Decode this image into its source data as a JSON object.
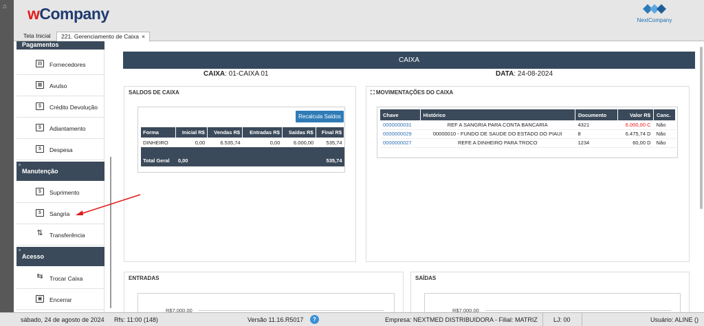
{
  "header": {
    "brand_w": "w",
    "brand_rest": "Company",
    "partner": "NextCompany"
  },
  "tabs": [
    {
      "label": "Tela Inicial"
    },
    {
      "label": "221. Gerenciamento de Caixa",
      "close": "×"
    }
  ],
  "sidebar": {
    "sections": [
      {
        "label": "Pagamentos"
      },
      {
        "label": "Manutenção"
      },
      {
        "label": "Acesso"
      }
    ],
    "items": [
      {
        "label": "Fornecedores",
        "icon": "truck-icon"
      },
      {
        "label": "Avulso",
        "icon": "register-icon"
      },
      {
        "label": "Crédito Devolução",
        "icon": "money-hand-icon"
      },
      {
        "label": "Adiantamento",
        "icon": "cash-icon"
      },
      {
        "label": "Despesa",
        "icon": "document-money-icon"
      },
      {
        "label": "Suprimento",
        "icon": "cash-in-icon"
      },
      {
        "label": "Sangria",
        "icon": "cash-out-icon"
      },
      {
        "label": "Transferência",
        "icon": "transfer-arrows-icon"
      },
      {
        "label": "Trocar Caixa",
        "icon": "swap-icon"
      },
      {
        "label": "Encerrar",
        "icon": "cash-register-icon"
      }
    ]
  },
  "main": {
    "banner": "CAIXA",
    "caixa_label": "CAIXA",
    "caixa_value": ": 01-CAIXA 01",
    "data_label": "DATA",
    "data_value": ": 24-08-2024",
    "saldos": {
      "title": "SALDOS DE CAIXA",
      "button": "Recalcula Saldos",
      "columns": [
        "Forma",
        "Inicial R$",
        "Vendas R$",
        "Entradas R$",
        "Saídas R$",
        "Final R$"
      ],
      "rows": [
        [
          "DINHEIRO",
          "0,00",
          "6.535,74",
          "0,00",
          "6.000,00",
          "535,74"
        ]
      ],
      "total": {
        "label": "Total Geral",
        "inicial": "0,00",
        "final": "535,74"
      }
    },
    "movimentacoes": {
      "title": "MOVIMENTAÇÕES DO CAIXA",
      "columns": [
        "Chave",
        "Histórico",
        "Documento",
        "Valor R$",
        "Canc."
      ],
      "rows": [
        [
          "0000000031",
          "REF A SANGRIA PARA CONTA BANCARIA",
          "4321",
          "6.000,00 C",
          "Não"
        ],
        [
          "0000000029",
          "00000010 - FUNDO DE SAUDE DO ESTADO DO PIAUI",
          "8",
          "6.475,74 D",
          "Não"
        ],
        [
          "0000000027",
          "REFE A DINHEIRO PARA TROCO",
          "1234",
          "60,00 D",
          "Não"
        ]
      ]
    },
    "entradas": {
      "title": "ENTRADAS",
      "ytick": "R$7.000,00"
    },
    "saidas": {
      "title": "SAÍDAS",
      "ytick": "R$7.000,00"
    }
  },
  "status": {
    "date": "sábado, 24 de agosto de 2024",
    "rfs": "Rfs: 11:00 (148)",
    "version": "Versão 11.16.R5017",
    "help": "?",
    "empresa": "Empresa: NEXTMED DISTRIBUIDORA - Filial: MATRIZ",
    "lj": "LJ: 00",
    "usuario": "Usuário: ALINE ()"
  },
  "colors": {
    "dark": "#34495e",
    "accent": "#2e7bb7",
    "brand_red": "#e31d1d",
    "brand_blue": "#1f3b70",
    "credit_red": "#e11111"
  }
}
